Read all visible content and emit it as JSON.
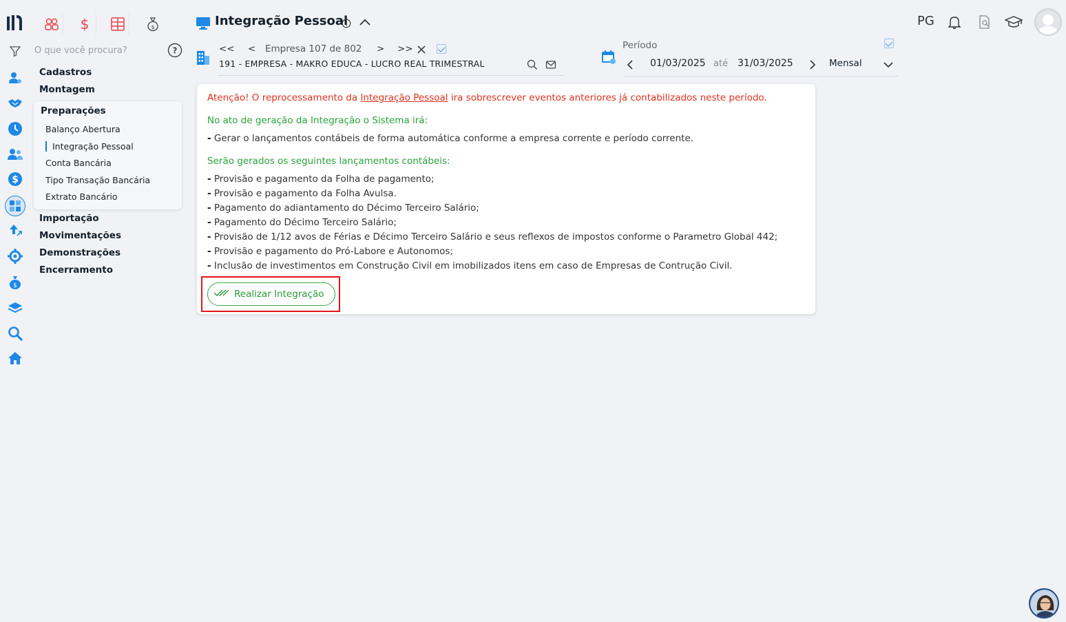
{
  "app": {
    "title": "Integração Pessoal",
    "user_initials": "PG"
  },
  "search": {
    "placeholder": "O que você procura?"
  },
  "nav": {
    "items": [
      "Cadastros",
      "Montagem",
      "Preparações",
      "Importação",
      "Movimentações",
      "Demonstrações",
      "Encerramento"
    ],
    "submenu_title": "Preparações",
    "submenu": [
      "Balanço Abertura",
      "Integração Pessoal",
      "Conta Bancária",
      "Tipo Transação Bancária",
      "Extrato Bancário"
    ],
    "active_submenu": "Integração Pessoal"
  },
  "company": {
    "nav_first": "<<",
    "nav_prev": "<",
    "label": "Empresa 107 de 802",
    "nav_next": ">",
    "nav_last": ">>",
    "name": "191 - EMPRESA - MAKRO EDUCA - LUCRO REAL TRIMESTRAL"
  },
  "period": {
    "label": "Período",
    "start": "01/03/2025",
    "sep": "até",
    "end": "31/03/2025",
    "mode": "Mensal"
  },
  "card": {
    "warning_pre": "Atenção! O reprocessamento da ",
    "warning_link": "Integração Pessoal",
    "warning_post": " ira sobrescrever eventos anteriores já contabilizados neste período.",
    "heading1": "No ato de geração da Integração o Sistema irá:",
    "line1": "Gerar o lançamentos contábeis de forma automática conforme a empresa corrente e período corrente.",
    "heading2": "Serão gerados os seguintes lançamentos contábeis:",
    "items": [
      "Provisão e pagamento da Folha de pagamento;",
      "Provisão e pagamento da Folha Avulsa.",
      "Pagamento do adiantamento do Décimo Terceiro Salário;",
      "Pagamento do Décimo Terceiro Salário;",
      "Provisão de 1/12 avos de Férias e Décimo Terceiro Salário e seus reflexos de impostos conforme o Parametro Global 442;",
      "Provisão e pagamento do Pró-Labore e Autonomos;",
      "Inclusão de investimentos em Construção Civil em imobilizados itens em caso de Empresas de Contrução Civil."
    ],
    "dash": "-",
    "button": "Realizar Integração"
  },
  "colors": {
    "accent": "#1976d2",
    "warning": "#e0301e",
    "success": "#2aa23a",
    "highlight": "#e3141b",
    "module_icons": "#e8434a"
  },
  "icons": {
    "rail": [
      "logo",
      "filter-icon",
      "user-settings-icon",
      "handshake-icon",
      "clock-icon",
      "users-icon",
      "dollar-icon",
      "calculator-icon",
      "upload-icon",
      "gear-icon",
      "money-bag-icon",
      "layers-icon",
      "search-icon",
      "home-icon"
    ],
    "modules": [
      "people-icon",
      "dollar-icon",
      "grid-icon",
      "money-bag-icon"
    ],
    "top_right": [
      "bell-icon",
      "document-search-icon",
      "graduation-cap-icon",
      "avatar"
    ]
  }
}
